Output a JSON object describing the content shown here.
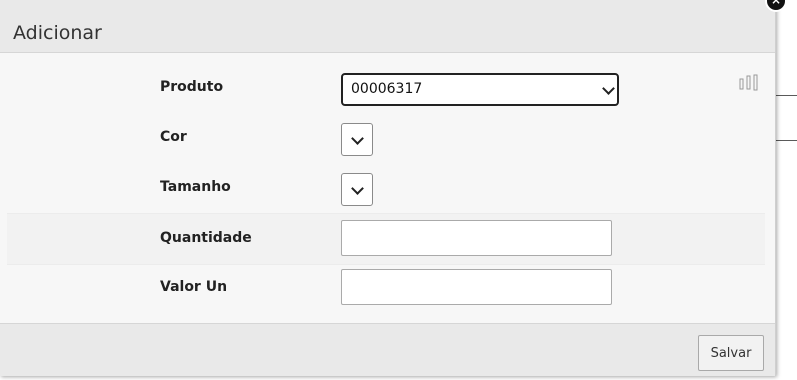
{
  "modal": {
    "title": "Adicionar",
    "close_icon": "close-icon",
    "settings_icon": "columns-icon"
  },
  "form": {
    "produto": {
      "label": "Produto",
      "value": "00006317"
    },
    "cor": {
      "label": "Cor",
      "value": ""
    },
    "tamanho": {
      "label": "Tamanho",
      "value": ""
    },
    "quantidade": {
      "label": "Quantidade",
      "value": ""
    },
    "valor_un": {
      "label": "Valor Un",
      "value": ""
    }
  },
  "footer": {
    "save_label": "Salvar"
  }
}
